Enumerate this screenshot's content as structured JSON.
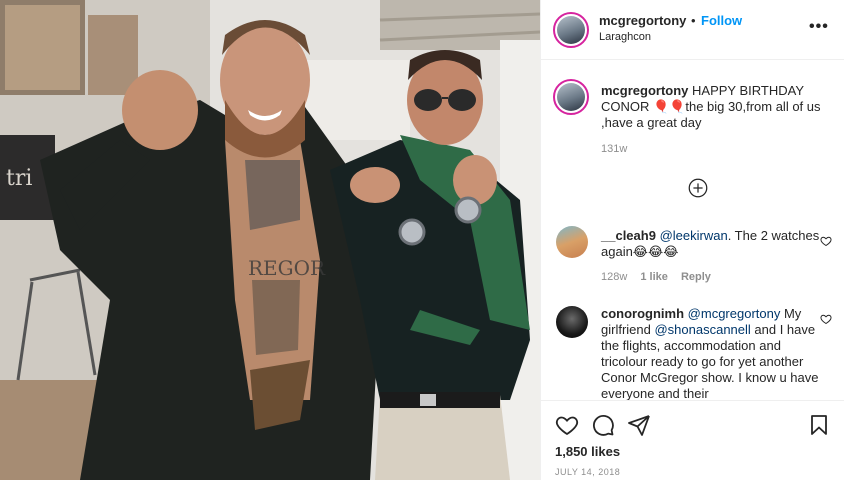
{
  "post": {
    "author": "mcgregortony",
    "follow_label": "Follow",
    "separator": "•",
    "location": "Laraghcon",
    "more_label": "•••",
    "caption": {
      "user": "mcgregortony",
      "text": "HAPPY BIRTHDAY CONOR 🎈🎈the big 30,from all of us ,have a great day",
      "time": "131w"
    },
    "comments": [
      {
        "user": "__cleah9",
        "mention": "@leekirwan",
        "text": ". The 2 watches again😂😂😂",
        "time": "128w",
        "likes": "1 like",
        "reply": "Reply"
      },
      {
        "user": "conorognimh",
        "mention": "@mcgregortony",
        "text_1": " My girlfriend ",
        "mention_2": "@shonascannell",
        "text_2": " and I have the flights, accommodation and tricolour ready to go for yet another Conor McGregor show. I know u have everyone and their"
      }
    ],
    "likes_count": "1,850 likes",
    "date": "JULY 14, 2018"
  },
  "icons": {
    "load_more": "plus-circle-icon",
    "like": "heart-icon",
    "comment": "comment-icon",
    "share": "share-icon",
    "save": "bookmark-icon"
  },
  "colors": {
    "link": "#0095f6",
    "mention": "#00376b",
    "meta": "#8e8e8e",
    "story_ring": "#d6249f"
  }
}
